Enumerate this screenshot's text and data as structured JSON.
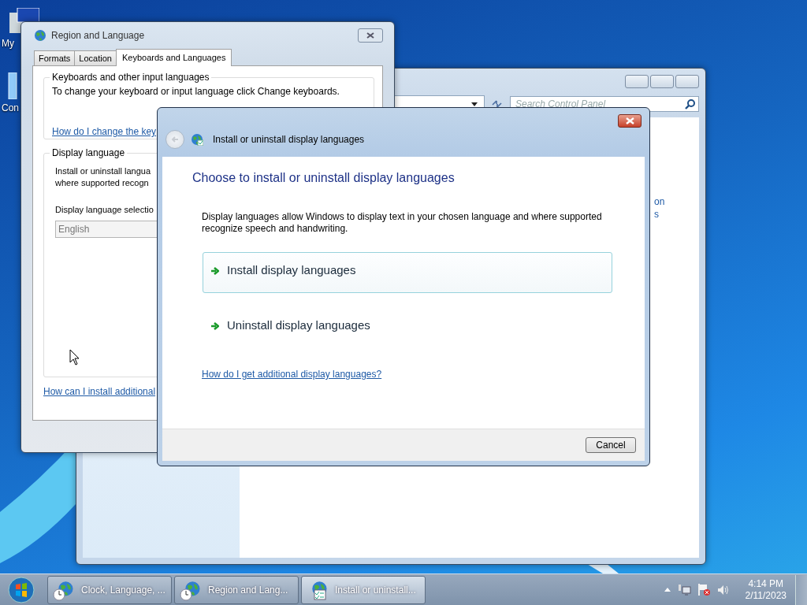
{
  "desktop": {
    "icons": [
      {
        "label": "My"
      },
      {
        "label": "Con"
      }
    ]
  },
  "control_panel": {
    "search": {
      "placeholder": "Search Control Panel"
    },
    "fragments": [
      "on",
      "s"
    ]
  },
  "region_window": {
    "title": "Region and Language",
    "tabs": [
      {
        "label": "Formats",
        "selected": false
      },
      {
        "label": "Location",
        "selected": false
      },
      {
        "label": "Keyboards and Languages",
        "selected": true
      }
    ],
    "keyboards_group": {
      "title": "Keyboards and other input languages",
      "text": "To change your keyboard or input language click Change keyboards.",
      "link": "How do I change the key"
    },
    "display_group": {
      "title": "Display language",
      "text_lines": [
        "Install or uninstall langua",
        "where supported recogn"
      ],
      "selection_label": "Display language selectio",
      "selection_value": "English"
    },
    "link": "How can I install additional"
  },
  "dialog": {
    "title": "Install or uninstall display languages",
    "heading": "Choose to install or uninstall display languages",
    "description": "Display languages allow Windows to display text in your chosen language and where supported recognize speech and handwriting.",
    "commands": [
      {
        "label": "Install display languages",
        "selected": true
      },
      {
        "label": "Uninstall display languages",
        "selected": false
      }
    ],
    "link": "How do I get additional display languages?",
    "buttons": [
      "Cancel"
    ]
  },
  "taskbar": {
    "buttons": [
      {
        "label": "Clock, Language, ...",
        "kind": "clock",
        "selected": false
      },
      {
        "label": "Region and Lang...",
        "kind": "clock",
        "selected": false
      },
      {
        "label": "Install or uninstall...",
        "kind": "checklist",
        "selected": true
      }
    ],
    "clock": {
      "time": "4:14 PM",
      "date": "2/11/2023"
    }
  }
}
